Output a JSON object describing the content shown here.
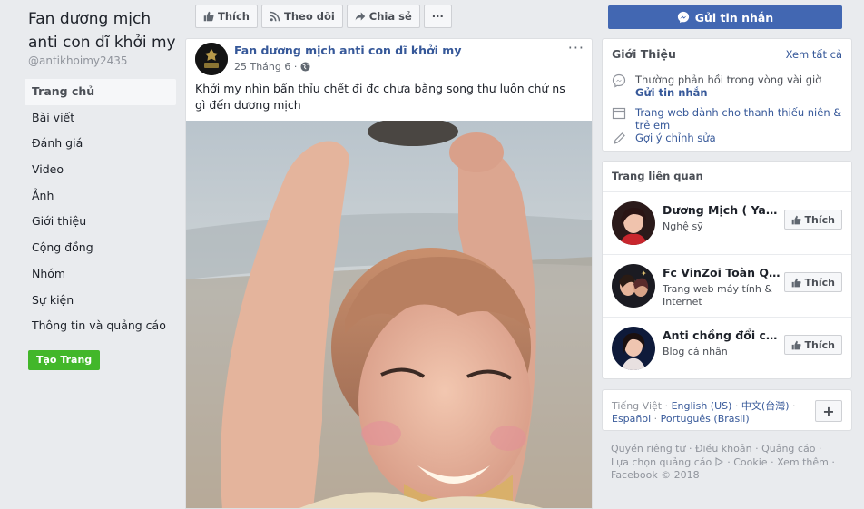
{
  "page": {
    "name": "Fan dương mịch anti con dĩ khởi my",
    "handle": "@antikhoimy2435"
  },
  "nav": {
    "items": [
      "Trang chủ",
      "Bài viết",
      "Đánh giá",
      "Video",
      "Ảnh",
      "Giới thiệu",
      "Cộng đồng",
      "Nhóm",
      "Sự kiện",
      "Thông tin và quảng cáo"
    ],
    "active_index": 0,
    "create_page": "Tạo Trang"
  },
  "actions": {
    "like": "Thích",
    "follow": "Theo dõi",
    "share": "Chia sẻ",
    "more": "···",
    "send_message": "Gửi tin nhắn"
  },
  "post": {
    "author": "Fan dương mịch anti con dĩ khởi my",
    "date": "25 Tháng 6 ·",
    "menu": "···",
    "text": "Khởi my nhìn bẩn thỉu chết đi đc chưa bằng song thư luôn chứ ns gì đến dương mịch"
  },
  "about": {
    "title": "Giới Thiệu",
    "see_all": "Xem tất cả",
    "response": "Thường phản hồi trong vòng vài giờ",
    "send_message": "Gửi tin nhắn",
    "category": "Trang web dành cho thanh thiếu niên & trẻ em",
    "suggest_edit": "Gợi ý chỉnh sửa"
  },
  "related": {
    "title": "Trang liên quan",
    "like_label": "Thích",
    "pages": [
      {
        "name": "Dương Mịch ( YangMi )",
        "category": "Nghệ sỹ"
      },
      {
        "name": "Fc VinZoi Toàn Quốc",
        "category": "Trang web máy tính & Internet"
      },
      {
        "name": "Anti chồng đổi con điên",
        "category": "Blog cá nhân"
      }
    ]
  },
  "languages": {
    "current": "Tiếng Việt",
    "sep1": " · ",
    "english": "English (US)",
    "sep2": " · ",
    "chinese": "中文(台灣)",
    "sep3": " · ",
    "spanish": "Español",
    "sep4": " · ",
    "portuguese": "Português (Brasil)",
    "plus": "+"
  },
  "footer": {
    "privacy": "Quyền riêng tư",
    "terms": "Điều khoản",
    "ads": "Quảng cáo",
    "ad_choices": "Lựa chọn quảng cáo",
    "cookie": "Cookie",
    "more": "Xem thêm",
    "copyright": "Facebook © 2018"
  },
  "colors": {
    "brand_blue": "#4267b2",
    "link_blue": "#365899",
    "create_green": "#42b72a",
    "background": "#e9ebee"
  }
}
